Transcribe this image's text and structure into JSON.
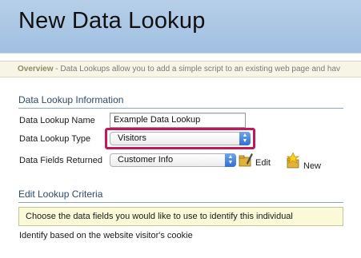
{
  "header": {
    "title": "New Data Lookup"
  },
  "overview": {
    "label": "Overview",
    "text": " - Data Lookups allow you to add a simple script to an existing web page and hav"
  },
  "info_section": {
    "title": "Data Lookup Information",
    "name_label": "Data Lookup Name",
    "name_value": "Example Data Lookup",
    "type_label": "Data Lookup Type",
    "type_value": "Visitors",
    "fields_label": "Data Fields Returned",
    "fields_value": "Customer Info",
    "edit_label": "Edit",
    "new_label": "New"
  },
  "criteria_section": {
    "title": "Edit Lookup Criteria",
    "box_text": "Choose the data fields you would like to use to identify this individual",
    "note": "Identify based on the website visitor's cookie"
  },
  "colors": {
    "header_gradient_top": "#b7cfe8",
    "highlight_border": "#c2185b",
    "section_title": "#2a4a6e",
    "overview_bg": "#f7f5e6",
    "criteria_bg": "#fbfad8"
  },
  "icons": [
    "select-arrows-icon",
    "edit-folder-icon",
    "new-star-icon"
  ]
}
